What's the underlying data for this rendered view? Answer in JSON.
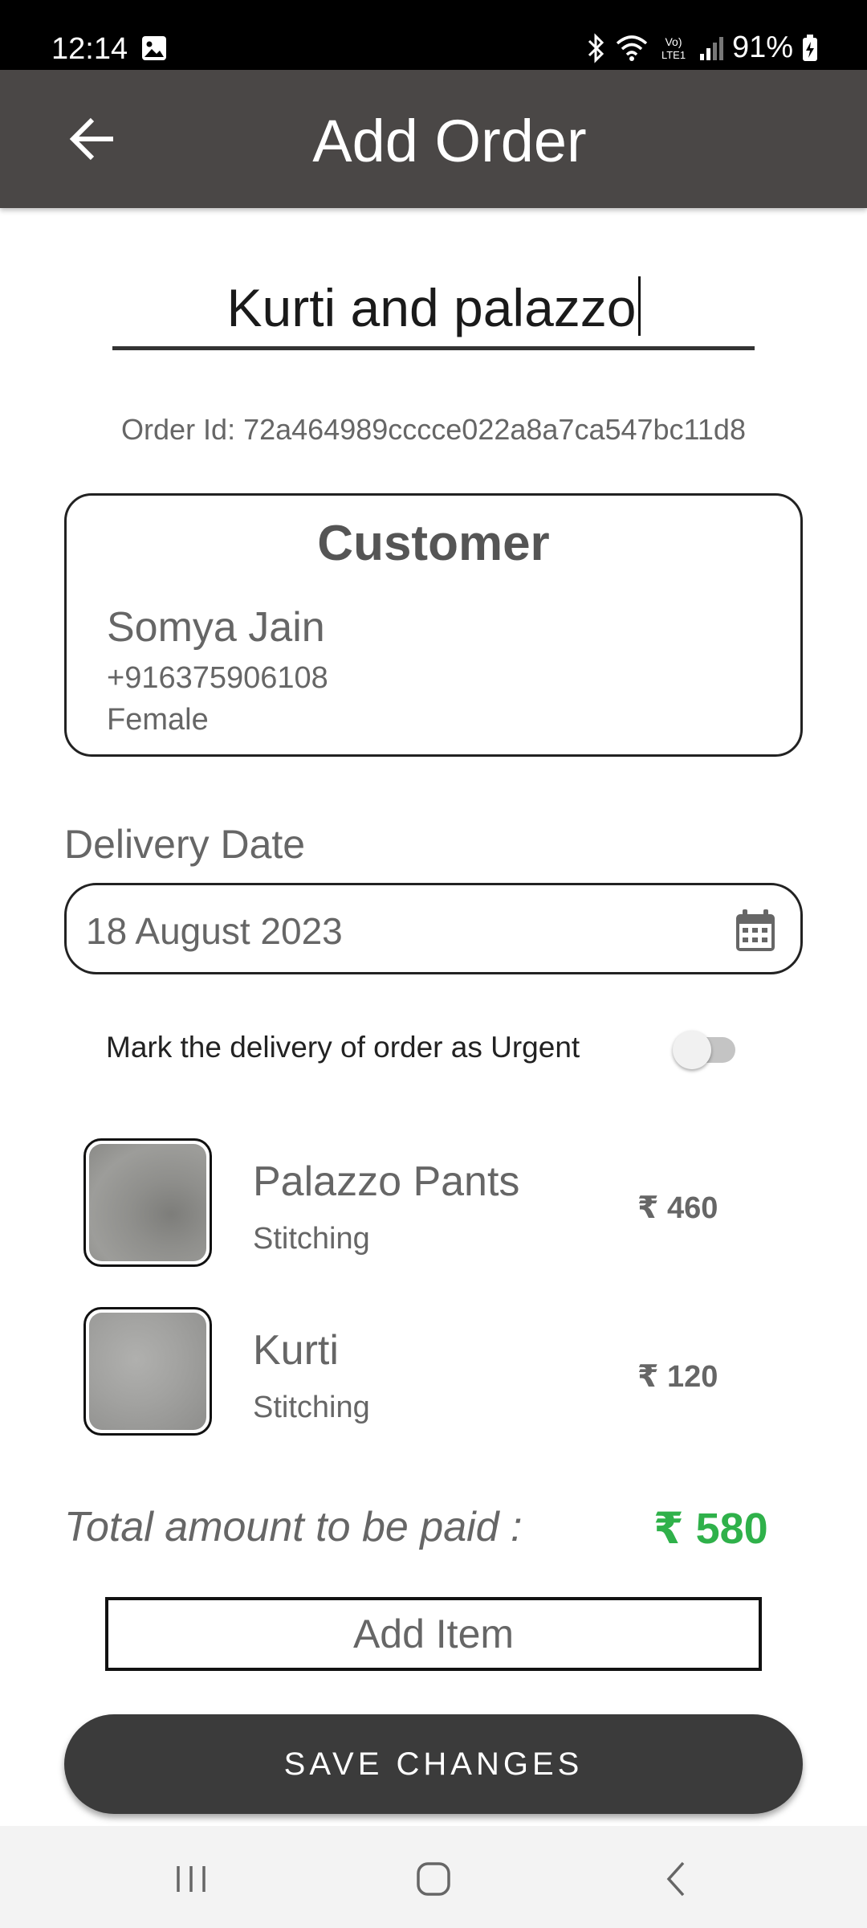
{
  "status_bar": {
    "time": "12:14",
    "battery": "91%",
    "network_label": "Vo) LTE1"
  },
  "header": {
    "title": "Add Order",
    "back_icon": "arrow-left-icon"
  },
  "order": {
    "name": "Kurti and palazzo",
    "id_text": "Order Id: 72a464989cccce022a8a7ca547bc11d8"
  },
  "customer": {
    "title": "Customer",
    "name": "Somya Jain",
    "phone": "+916375906108",
    "gender": "Female"
  },
  "delivery": {
    "label": "Delivery Date",
    "date": "18 August 2023",
    "urgent_label": "Mark the delivery of order as Urgent",
    "urgent_on": false
  },
  "items": [
    {
      "name": "Palazzo Pants",
      "service": "Stitching",
      "price": "₹ 460"
    },
    {
      "name": "Kurti",
      "service": "Stitching",
      "price": "₹ 120"
    }
  ],
  "total": {
    "label": "Total amount to be paid :",
    "value": "₹ 580",
    "color": "#2fb14a"
  },
  "actions": {
    "add_item": "Add Item",
    "save": "SAVE CHANGES"
  },
  "colors": {
    "app_bar": "#4a4746",
    "save_button": "#3b3b3b"
  }
}
